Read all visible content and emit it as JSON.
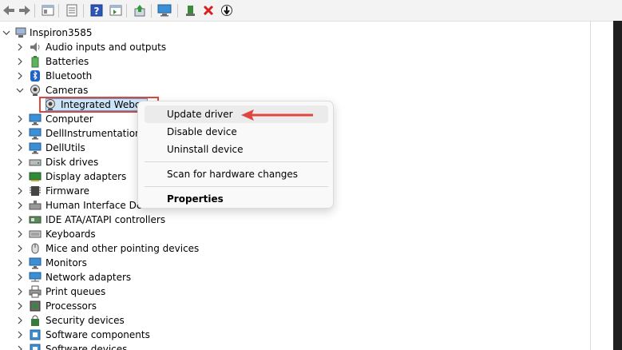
{
  "toolbar": {
    "buttons": [
      "back-icon",
      "forward-icon",
      "show-hide-console-tree-icon",
      "properties-icon",
      "help-icon",
      "action-pane-icon",
      "update-driver-icon",
      "scan-hardware-icon",
      "enable-device-icon",
      "uninstall-icon",
      "disable-device-icon"
    ]
  },
  "tree": {
    "root": "Inspiron3585",
    "items": [
      {
        "label": "Audio inputs and outputs",
        "icon": "speaker-icon"
      },
      {
        "label": "Batteries",
        "icon": "battery-icon"
      },
      {
        "label": "Bluetooth",
        "icon": "bluetooth-icon"
      },
      {
        "label": "Cameras",
        "icon": "camera-icon",
        "expanded": true,
        "children": [
          {
            "label": "Integrated Webca",
            "icon": "webcam-icon",
            "selected": true
          }
        ]
      },
      {
        "label": "Computer",
        "icon": "monitor-icon"
      },
      {
        "label": "DellInstrumentation",
        "icon": "monitor-icon"
      },
      {
        "label": "DellUtils",
        "icon": "monitor-icon"
      },
      {
        "label": "Disk drives",
        "icon": "disk-icon"
      },
      {
        "label": "Display adapters",
        "icon": "display-adapter-icon"
      },
      {
        "label": "Firmware",
        "icon": "chip-icon"
      },
      {
        "label": "Human Interface Dev",
        "icon": "hid-icon"
      },
      {
        "label": "IDE ATA/ATAPI controllers",
        "icon": "ide-icon"
      },
      {
        "label": "Keyboards",
        "icon": "keyboard-icon"
      },
      {
        "label": "Mice and other pointing devices",
        "icon": "mouse-icon"
      },
      {
        "label": "Monitors",
        "icon": "monitor-icon"
      },
      {
        "label": "Network adapters",
        "icon": "network-icon"
      },
      {
        "label": "Print queues",
        "icon": "printer-icon"
      },
      {
        "label": "Processors",
        "icon": "processor-icon"
      },
      {
        "label": "Security devices",
        "icon": "security-icon"
      },
      {
        "label": "Software components",
        "icon": "software-icon"
      },
      {
        "label": "Software devices",
        "icon": "software-icon"
      }
    ]
  },
  "context_menu": {
    "items": [
      {
        "label": "Update driver",
        "hover": true
      },
      {
        "label": "Disable device"
      },
      {
        "label": "Uninstall device"
      },
      {
        "label": "Scan for hardware changes"
      },
      {
        "label": "Properties",
        "bold": true
      }
    ]
  },
  "colors": {
    "highlight_box": "#e0463d",
    "arrow": "#e0463d",
    "selection": "#cce4f7"
  }
}
